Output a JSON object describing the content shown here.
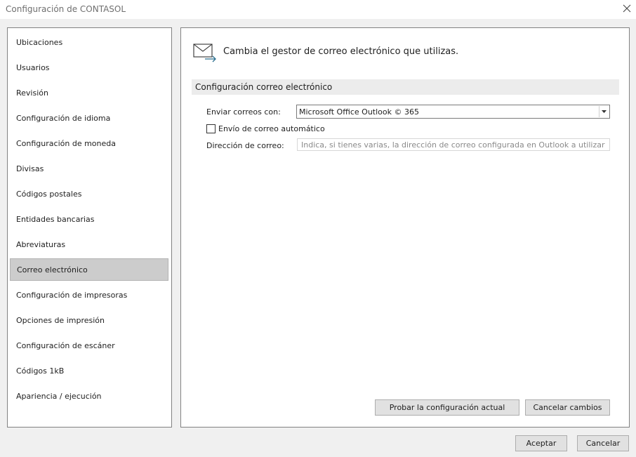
{
  "window": {
    "title": "Configuración de CONTASOL"
  },
  "sidebar": {
    "selected_index": 9,
    "items": [
      {
        "label": "Ubicaciones"
      },
      {
        "label": "Usuarios"
      },
      {
        "label": "Revisión"
      },
      {
        "label": "Configuración de idioma"
      },
      {
        "label": "Configuración de moneda"
      },
      {
        "label": "Divisas"
      },
      {
        "label": "Códigos postales"
      },
      {
        "label": "Entidades bancarias"
      },
      {
        "label": "Abreviaturas"
      },
      {
        "label": "Correo electrónico"
      },
      {
        "label": "Configuración de impresoras"
      },
      {
        "label": "Opciones de impresión"
      },
      {
        "label": "Configuración de escáner"
      },
      {
        "label": "Códigos 1kB"
      },
      {
        "label": "Apariencia / ejecución"
      }
    ]
  },
  "main": {
    "header_icon": "mail-forward-icon",
    "header_text": "Cambia el gestor de correo electrónico que utilizas.",
    "section_title": "Configuración correo electrónico",
    "send_with": {
      "label": "Enviar correos con:",
      "value": "Microsoft Office Outlook © 365"
    },
    "auto_send": {
      "label": "Envío de correo automático",
      "checked": false
    },
    "email_address": {
      "label": "Dirección de correo:",
      "value": "",
      "placeholder": "Indica, si tienes varias, la dirección de correo configurada en Outlook a utilizar"
    },
    "test_button_label": "Probar la configuración actual",
    "cancel_changes_label": "Cancelar cambios"
  },
  "footer": {
    "accept_label": "Aceptar",
    "cancel_label": "Cancelar"
  },
  "colors": {
    "window_bg": "#f0f0f0",
    "selected_item_bg": "#cccccc",
    "section_band_bg": "#ececec",
    "icon_accent": "#2b6f8f"
  }
}
